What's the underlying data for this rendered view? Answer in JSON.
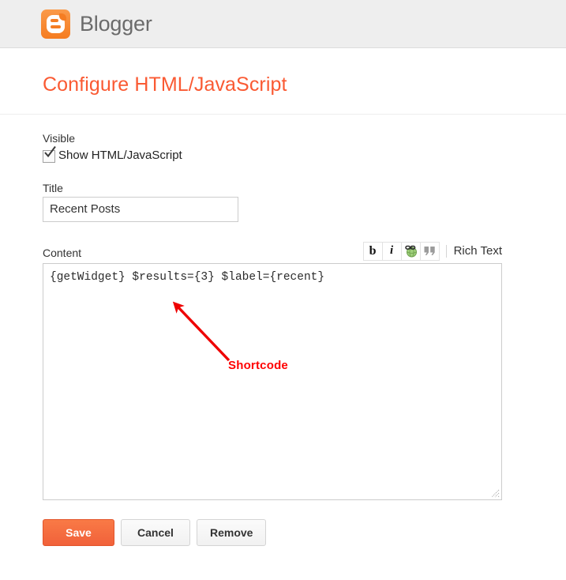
{
  "header": {
    "brand_name": "Blogger",
    "logo_icon": "blogger-logo-icon"
  },
  "page": {
    "title": "Configure HTML/JavaScript",
    "title_color": "#fa5a33"
  },
  "form": {
    "visible": {
      "label": "Visible",
      "checkbox_label": "Show HTML/JavaScript",
      "checked": true
    },
    "title_field": {
      "label": "Title",
      "value": "Recent Posts",
      "placeholder": ""
    },
    "content_field": {
      "label": "Content",
      "value": "{getWidget} $results={3} $label={recent}",
      "placeholder": ""
    }
  },
  "toolbar": {
    "bold_label": "b",
    "italic_label": "i",
    "link_icon": "globe-link-icon",
    "quote_label": "“",
    "rich_text_label": "Rich Text"
  },
  "buttons": {
    "save_label": "Save",
    "cancel_label": "Cancel",
    "remove_label": "Remove",
    "save_color": "#f4683c"
  },
  "annotation": {
    "label": "Shortcode",
    "color": "#ff0000",
    "arrow_icon": "red-arrow-icon"
  }
}
